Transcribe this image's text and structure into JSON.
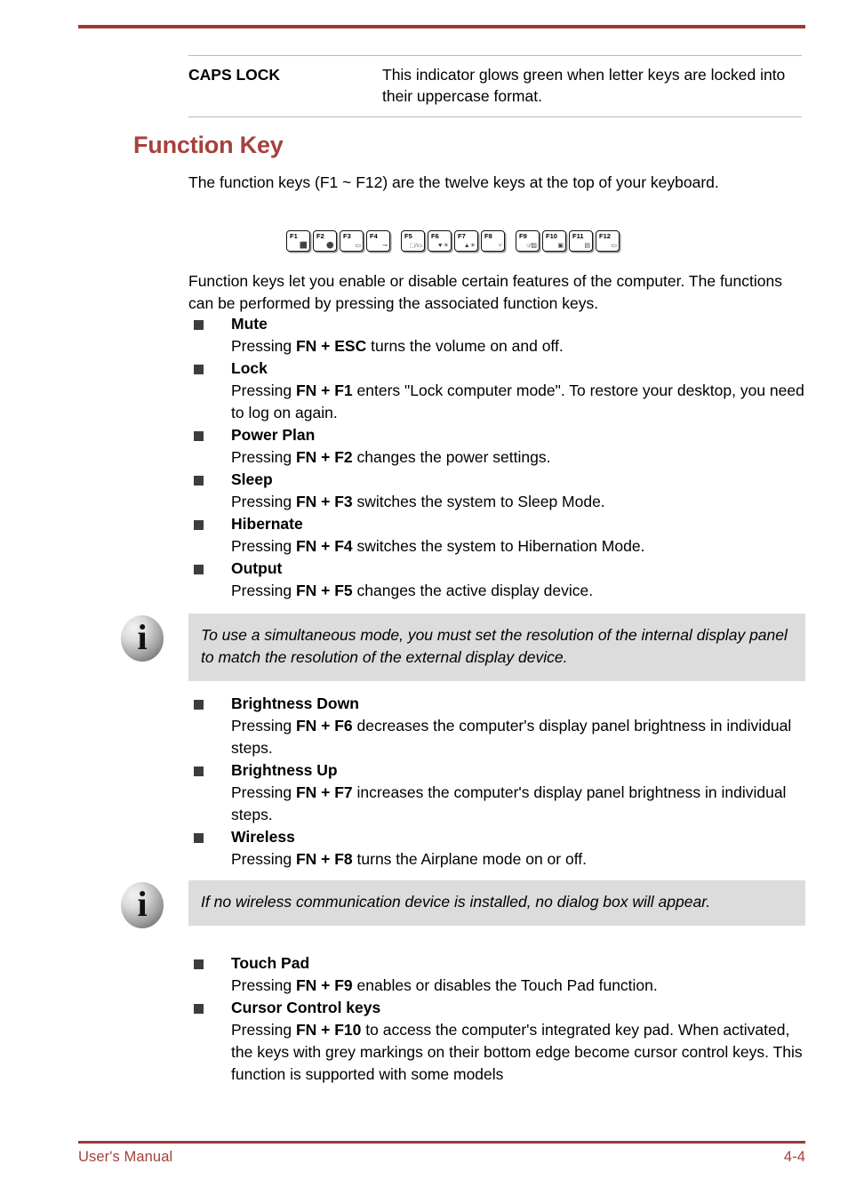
{
  "document": {
    "rule_color": "#9e3836",
    "heading_color": "#a5413c",
    "bullet_color": "#3d3d3d",
    "note_bg": "#dcdcdc"
  },
  "indicator_table": {
    "rows": [
      {
        "term": "CAPS LOCK",
        "definition": "This indicator glows green when letter keys are locked into their uppercase format."
      }
    ]
  },
  "section": {
    "heading": "Function Key",
    "intro_paragraph": "The function keys (F1 ~ F12) are the twelve keys at the top of your keyboard.",
    "second_paragraph": "Function keys let you enable or disable certain features of the computer. The functions can be performed by pressing the associated function keys."
  },
  "key_strip": {
    "keys": [
      {
        "label": "F1",
        "glyph": "⬛",
        "icon_name": "lock-key-icon",
        "gap_before": false
      },
      {
        "label": "F2",
        "glyph": "⚫",
        "icon_name": "power-plan-key-icon",
        "gap_before": false
      },
      {
        "label": "F3",
        "glyph": "▭",
        "icon_name": "sleep-key-icon",
        "gap_before": false
      },
      {
        "label": "F4",
        "glyph": "⊸",
        "icon_name": "hibernate-key-icon",
        "gap_before": false
      },
      {
        "label": "F5",
        "glyph": "⬚∕▭",
        "icon_name": "output-key-icon",
        "gap_before": true
      },
      {
        "label": "F6",
        "glyph": "▼☀",
        "icon_name": "brightness-down-key-icon",
        "gap_before": false
      },
      {
        "label": "F7",
        "glyph": "▲☀",
        "icon_name": "brightness-up-key-icon",
        "gap_before": false
      },
      {
        "label": "F8",
        "glyph": "⑂",
        "icon_name": "wireless-key-icon",
        "gap_before": false
      },
      {
        "label": "F9",
        "glyph": "○∕▨",
        "icon_name": "touch-pad-key-icon",
        "gap_before": true
      },
      {
        "label": "F10",
        "glyph": "▣",
        "icon_name": "cursor-control-key-icon",
        "gap_before": false
      },
      {
        "label": "F11",
        "glyph": "▤",
        "icon_name": "f11-key-icon",
        "gap_before": false
      },
      {
        "label": "F12",
        "glyph": "▭",
        "icon_name": "f12-key-icon",
        "gap_before": false
      }
    ]
  },
  "function_list_a": [
    {
      "title": "Mute",
      "body_pre": "Pressing ",
      "body_key": "FN + ESC",
      "body_post": " turns the volume on and off."
    },
    {
      "title": "Lock",
      "body_pre": "Pressing ",
      "body_key": "FN + F1",
      "body_post": " enters \"Lock computer mode\". To restore your desktop, you need to log on again."
    },
    {
      "title": "Power Plan",
      "body_pre": "Pressing ",
      "body_key": "FN + F2",
      "body_post": " changes the power settings."
    },
    {
      "title": "Sleep",
      "body_pre": "Pressing ",
      "body_key": "FN + F3",
      "body_post": " switches the system to Sleep Mode."
    },
    {
      "title": "Hibernate",
      "body_pre": "Pressing ",
      "body_key": "FN + F4",
      "body_post": " switches the system to Hibernation Mode."
    },
    {
      "title": "Output",
      "body_pre": "Pressing ",
      "body_key": "FN + F5",
      "body_post": " changes the active display device."
    }
  ],
  "note_1": {
    "icon_name": "info-icon",
    "text": "To use a simultaneous mode, you must set the resolution of the internal display panel to match the resolution of the external display device."
  },
  "function_list_b": [
    {
      "title": "Brightness Down",
      "body_pre": "Pressing ",
      "body_key": "FN + F6",
      "body_post": " decreases the computer's display panel brightness in individual steps."
    },
    {
      "title": "Brightness Up",
      "body_pre": "Pressing ",
      "body_key": "FN + F7",
      "body_post": " increases the computer's display panel brightness in individual steps."
    },
    {
      "title": "Wireless",
      "body_pre": "Pressing ",
      "body_key": "FN + F8",
      "body_post": " turns the Airplane mode on or off."
    }
  ],
  "note_2": {
    "icon_name": "info-icon",
    "text": "If no wireless communication device is installed, no dialog box will appear."
  },
  "function_list_c": [
    {
      "title": "Touch Pad",
      "body_pre": "Pressing ",
      "body_key": "FN + F9",
      "body_post": " enables or disables the Touch Pad function."
    },
    {
      "title": "Cursor Control keys",
      "body_pre": "Pressing ",
      "body_key": "FN + F10",
      "body_post": " to access the computer's integrated key pad. When activated, the keys with grey markings on their bottom edge become cursor control keys. This function is supported with some models"
    }
  ],
  "footer": {
    "left": "User's Manual",
    "right": "4-4"
  }
}
